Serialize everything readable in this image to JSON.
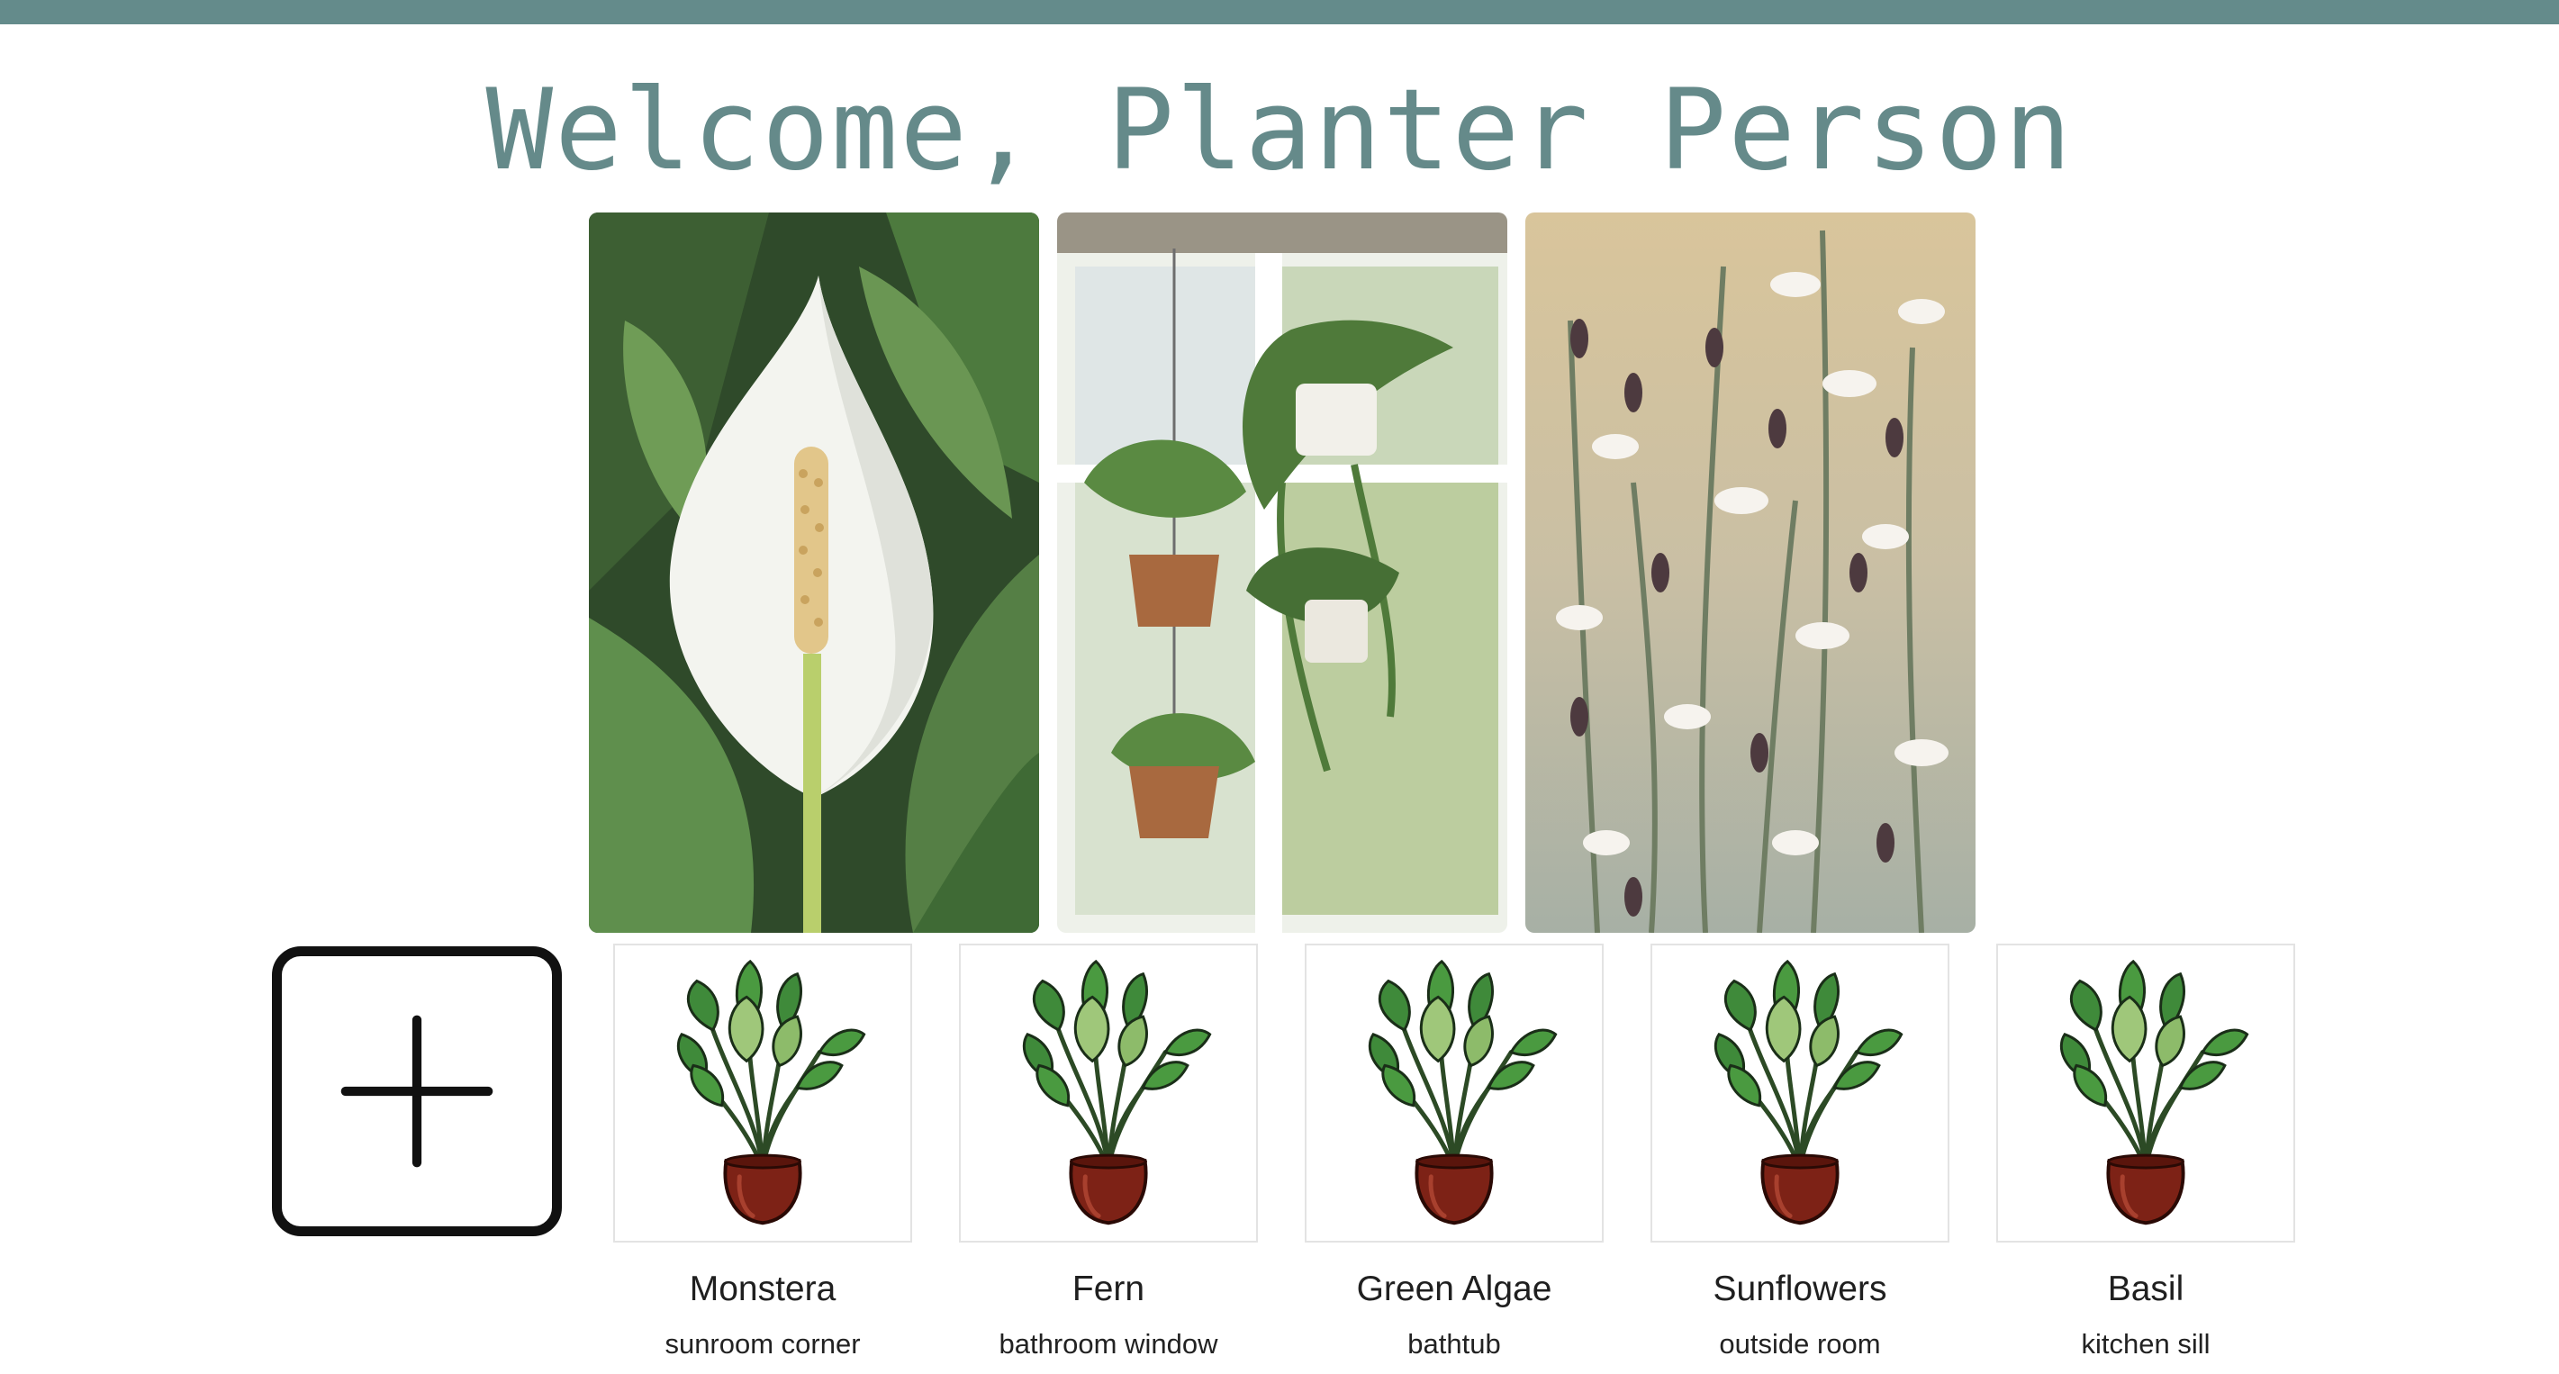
{
  "header": {
    "title": "Welcome, Planter Person",
    "accent_color": "#648b8b"
  },
  "hero_images": [
    {
      "icon": "peace-lily-photo"
    },
    {
      "icon": "hanging-plants-photo"
    },
    {
      "icon": "wildflowers-photo"
    }
  ],
  "add_button": {
    "icon": "plus-icon"
  },
  "plants": [
    {
      "name": "Monstera",
      "location": "sunroom corner",
      "icon": "potted-plant-icon"
    },
    {
      "name": "Fern",
      "location": "bathroom window",
      "icon": "potted-plant-icon"
    },
    {
      "name": "Green Algae",
      "location": "bathtub",
      "icon": "potted-plant-icon"
    },
    {
      "name": "Sunflowers",
      "location": "outside room",
      "icon": "potted-plant-icon"
    },
    {
      "name": "Basil",
      "location": "kitchen sill",
      "icon": "potted-plant-icon"
    }
  ]
}
